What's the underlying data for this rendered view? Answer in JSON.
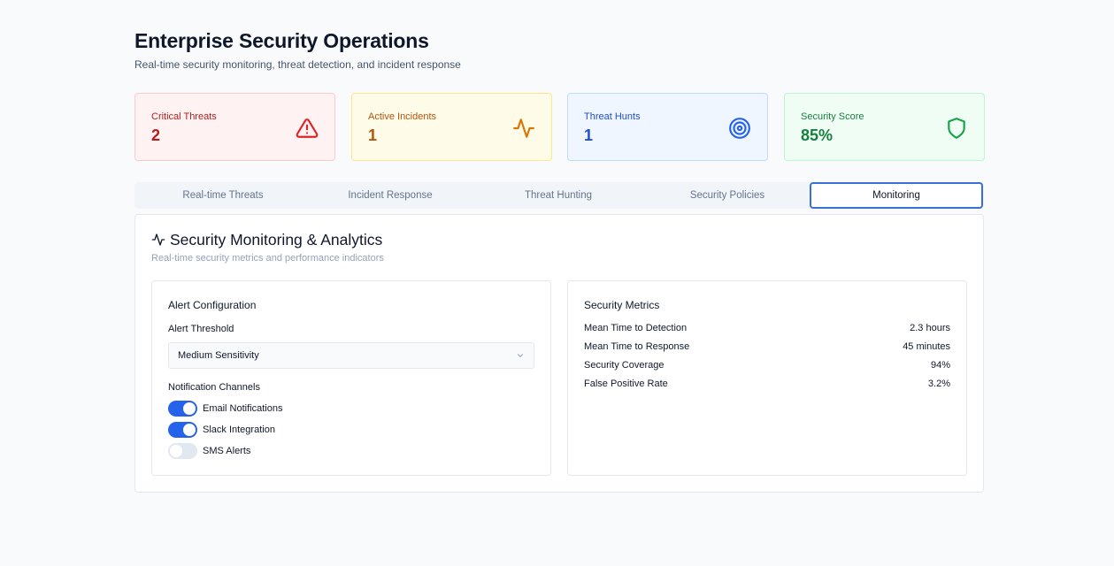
{
  "header": {
    "title": "Enterprise Security Operations",
    "subtitle": "Real-time security monitoring, threat detection, and incident response"
  },
  "stats": [
    {
      "label": "Critical Threats",
      "value": "2",
      "icon": "alert-triangle-icon",
      "color": "#b91c1c"
    },
    {
      "label": "Active Incidents",
      "value": "1",
      "icon": "activity-icon",
      "color": "#b45309"
    },
    {
      "label": "Threat Hunts",
      "value": "1",
      "icon": "target-icon",
      "color": "#1d4ed8"
    },
    {
      "label": "Security Score",
      "value": "85%",
      "icon": "shield-icon",
      "color": "#15803d"
    }
  ],
  "tabs": [
    {
      "label": "Real-time Threats",
      "active": false
    },
    {
      "label": "Incident Response",
      "active": false
    },
    {
      "label": "Threat Hunting",
      "active": false
    },
    {
      "label": "Security Policies",
      "active": false
    },
    {
      "label": "Monitoring",
      "active": true
    }
  ],
  "panel": {
    "icon": "activity-icon",
    "title": "Security Monitoring & Analytics",
    "description": "Real-time security metrics and performance indicators"
  },
  "alert_config": {
    "title": "Alert Configuration",
    "threshold_label": "Alert Threshold",
    "threshold_value": "Medium Sensitivity",
    "channels_label": "Notification Channels",
    "channels": [
      {
        "label": "Email Notifications",
        "enabled": true
      },
      {
        "label": "Slack Integration",
        "enabled": true
      },
      {
        "label": "SMS Alerts",
        "enabled": false
      }
    ]
  },
  "metrics": {
    "title": "Security Metrics",
    "rows": [
      {
        "label": "Mean Time to Detection",
        "value": "2.3 hours"
      },
      {
        "label": "Mean Time to Response",
        "value": "45 minutes"
      },
      {
        "label": "Security Coverage",
        "value": "94%"
      },
      {
        "label": "False Positive Rate",
        "value": "3.2%"
      }
    ]
  },
  "colors": {
    "accent": "#2563eb",
    "tab_active_border": "#3b6fd8"
  }
}
